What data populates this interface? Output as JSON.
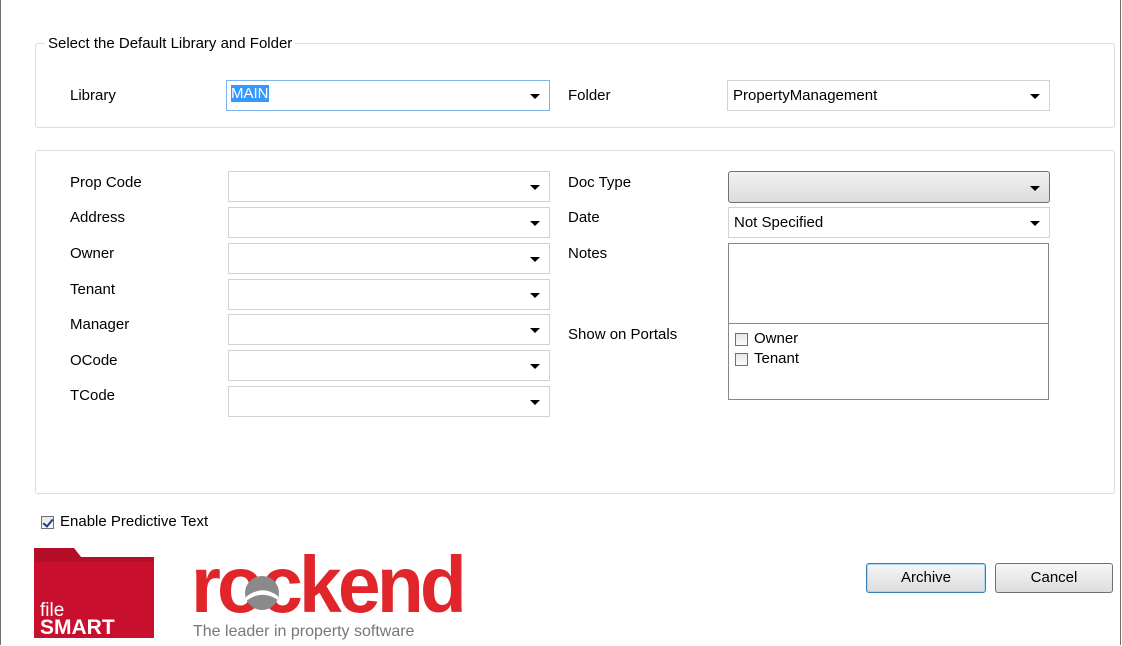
{
  "library_group": {
    "legend": "Select the Default Library and Folder",
    "library_label": "Library",
    "library_value": "MAIN",
    "folder_label": "Folder",
    "folder_value": "PropertyManagement"
  },
  "fields": {
    "prop_code_label": "Prop Code",
    "address_label": "Address",
    "owner_label": "Owner",
    "tenant_label": "Tenant",
    "manager_label": "Manager",
    "ocode_label": "OCode",
    "tcode_label": "TCode",
    "doc_type_label": "Doc Type",
    "doc_type_value": "",
    "date_label": "Date",
    "date_value": "Not Specified",
    "notes_label": "Notes",
    "portals_label": "Show on Portals",
    "portal_options": [
      {
        "label": "Owner",
        "checked": false
      },
      {
        "label": "Tenant",
        "checked": false
      }
    ]
  },
  "predictive": {
    "label": "Enable Predictive Text",
    "checked": true
  },
  "branding": {
    "filesmart_top": "file",
    "filesmart_bottom": "SMART",
    "rockend_word": "rockend",
    "rockend_tagline": "The leader in property software",
    "filesmart_color": "#c8102e",
    "rockend_color": "#e0262b"
  },
  "buttons": {
    "archive": "Archive",
    "cancel": "Cancel"
  }
}
